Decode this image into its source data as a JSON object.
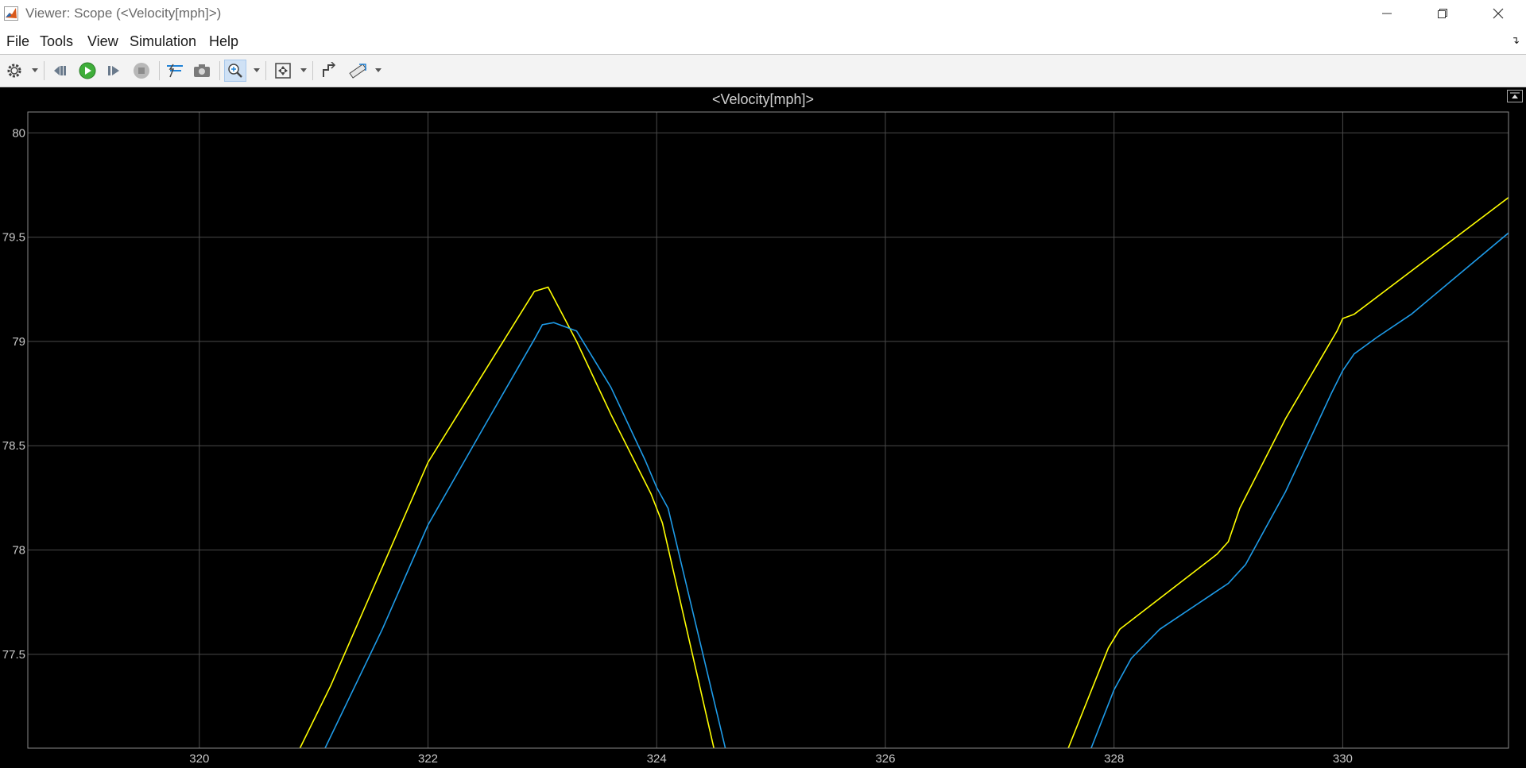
{
  "window": {
    "title": "Viewer: Scope (<Velocity[mph]>)"
  },
  "menu": [
    "File",
    "Tools",
    "View",
    "Simulation",
    "Help"
  ],
  "toolbar": {
    "icons": [
      "settings-icon",
      "step-back-icon",
      "run-icon",
      "step-forward-icon",
      "stop-icon",
      "highlight-icon",
      "snapshot-icon",
      "zoom-in-icon",
      "autoscale-icon",
      "style-icon",
      "measure-icon"
    ]
  },
  "plot": {
    "title": "<Velocity[mph]>",
    "colors": {
      "background": "#000000",
      "grid": "#4a4a4a",
      "series_a": "#ffff00",
      "series_b": "#1e9be8"
    }
  },
  "chart_data": {
    "type": "line",
    "title": "<Velocity[mph]>",
    "xlim": [
      318.5,
      331.45
    ],
    "ylim": [
      77.05,
      80.1
    ],
    "xticks": [
      320,
      322,
      324,
      326,
      328,
      330
    ],
    "xtick_labels": [
      "320",
      "322",
      "324",
      "326",
      "328",
      "330"
    ],
    "yticks": [
      77.5,
      78,
      78.5,
      79,
      79.5,
      80
    ],
    "ytick_labels": [
      "77.5",
      "78",
      "78.5",
      "79",
      "79.5",
      "80"
    ],
    "grid": true,
    "series": [
      {
        "color": "#ffff00",
        "x": [
          320.88,
          321.15,
          322.0,
          322.93,
          323.05,
          323.3,
          323.6,
          323.95,
          324.05,
          324.5,
          324.5,
          327.6,
          327.6,
          327.95,
          328.05,
          328.9,
          329.0,
          329.1,
          329.5,
          329.95,
          330.0,
          330.1,
          331.45
        ],
        "y": [
          77.05,
          77.35,
          78.42,
          79.24,
          79.26,
          79.0,
          78.65,
          78.27,
          78.13,
          77.05,
          null,
          null,
          77.05,
          77.53,
          77.62,
          77.98,
          78.04,
          78.2,
          78.63,
          79.05,
          79.11,
          79.13,
          79.69
        ]
      },
      {
        "color": "#1e9be8",
        "x": [
          321.1,
          321.6,
          322.0,
          322.5,
          322.93,
          323.0,
          323.1,
          323.3,
          323.6,
          323.9,
          324.0,
          324.1,
          324.6,
          324.6,
          327.8,
          327.8,
          328.0,
          328.15,
          328.4,
          329.0,
          329.05,
          329.15,
          329.5,
          329.9,
          330.0,
          330.1,
          330.3,
          330.6,
          331.45
        ],
        "y": [
          77.05,
          77.62,
          78.12,
          78.6,
          79.01,
          79.08,
          79.09,
          79.05,
          78.78,
          78.43,
          78.3,
          78.2,
          77.05,
          null,
          null,
          77.05,
          77.33,
          77.48,
          77.62,
          77.84,
          77.87,
          77.93,
          78.28,
          78.75,
          78.86,
          78.94,
          79.02,
          79.13,
          79.52
        ]
      }
    ]
  }
}
